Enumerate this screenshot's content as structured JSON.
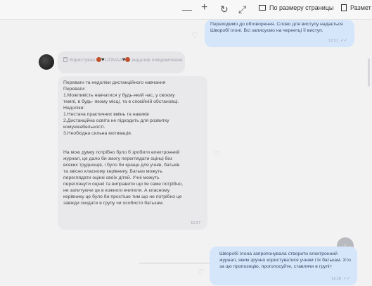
{
  "toolbar": {
    "zoom_out_glyph": "—",
    "zoom_in_glyph": "+",
    "rotate_glyph": "↻",
    "expand_glyph": "⤢",
    "fit_label": "По размеру страницы",
    "layout_label": "Размет"
  },
  "messages": [
    {
      "text": "Переходимо до обговорення. Слово для виступу надається Шворобї Ілоні. Всі записуємо на чернетці її виступ.",
      "time": "12:21"
    },
    {
      "deleted_text_1": "Користувач",
      "deleted_name": "LIONAA",
      "deleted_text_2": "видалив повідомлення"
    },
    {
      "lines": [
        "Переваги та недоліки дистанційного навчання",
        "Переваги:",
        "1.Можливість навчатися у будь-який час, у своєму",
        "темпі, в будь- якому місці, та в спокійній обстановці.",
        "Недоліки:",
        "1.Нестача практичних вмінь та навиків",
        "2.Дистанційна освіта не підходить для розвитку",
        "комунікабельності.",
        "3.Необхідна сильна мотивація.",
        "",
        "",
        "На мою думку потрібно було б зробити електронний",
        "журнал, це дало би змогу переглядати оцінці без",
        "всяких труднощів, і  було би краще для учнів, батьків",
        "та звісно класному керівнику. Батьки можуть",
        "переглядати оцінкі своїх дітей. Учні можуть",
        "переглянути оцінкі та виправити що їм саме потрібно,",
        "не запитуючи це в кожного вчителя. А класному",
        "керівнику це було би простіше тим що не потрібно це",
        "завжди скидати в групу чи особисто батькам."
      ],
      "time": "12:27"
    },
    {
      "text": "Шворобї Ілона запропонувала створити електронний журнал, яким зручно користуватися учням і їх батькам. Хто за цю пропозицію, проголосуйте, ставлячи в групі+",
      "time": "12:28"
    }
  ],
  "controls": {
    "scroll_down_glyph": "↓",
    "check_glyph": "✓✓"
  }
}
